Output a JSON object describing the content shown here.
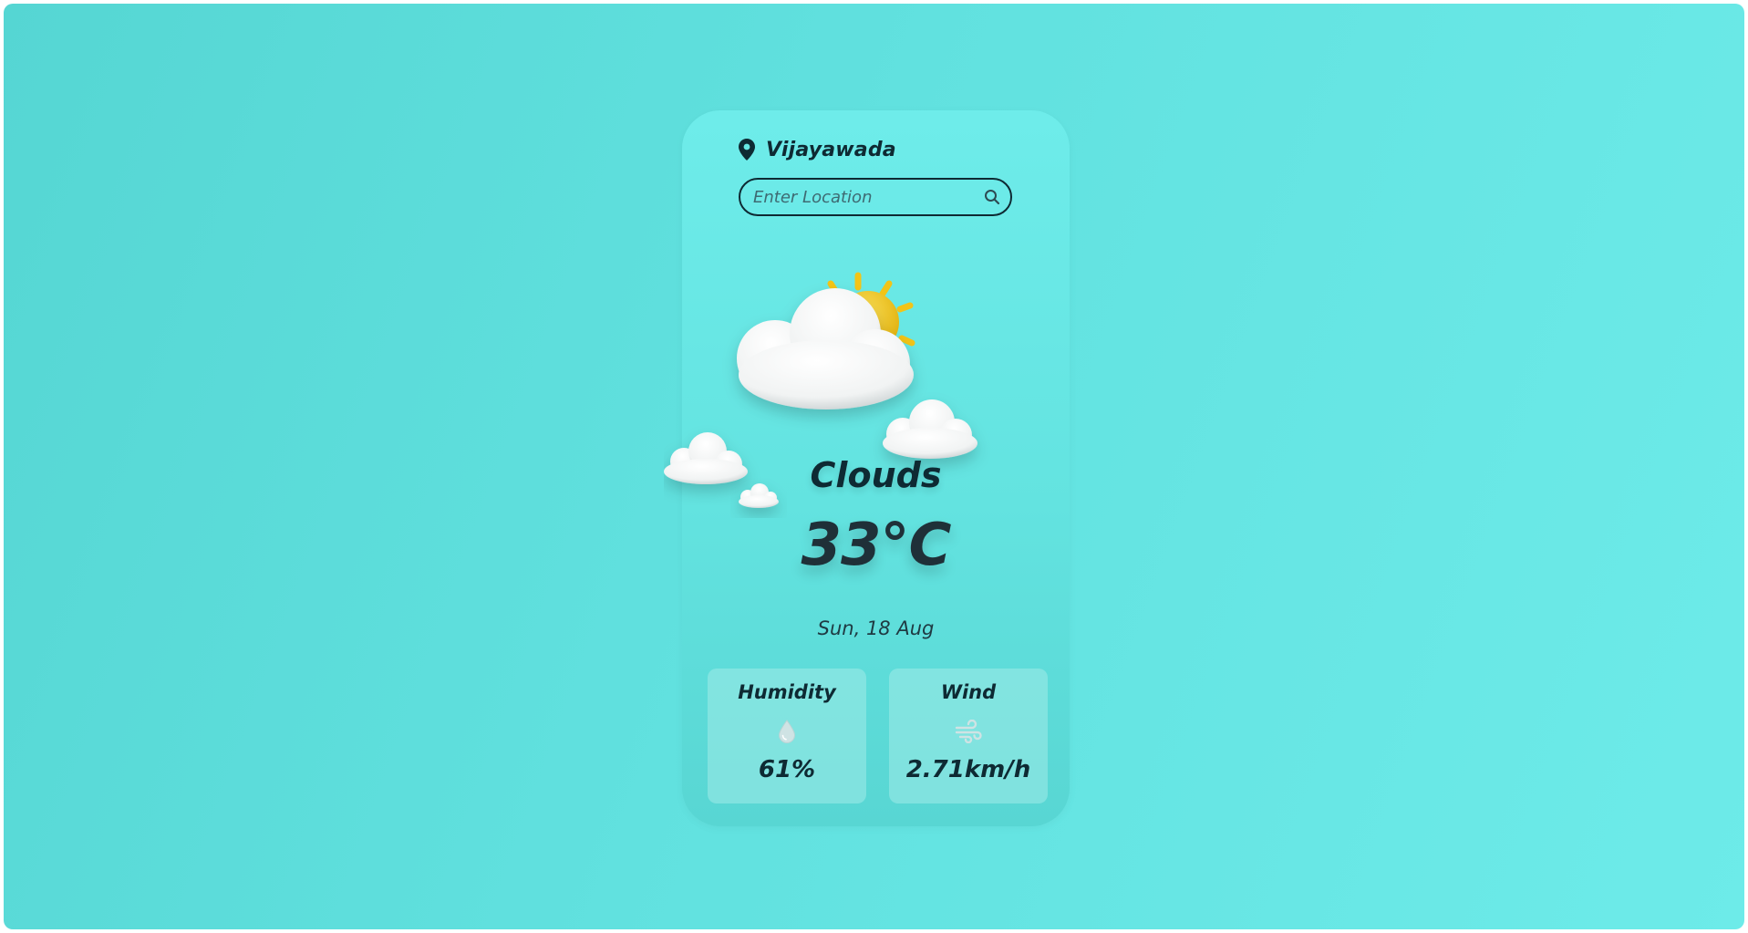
{
  "location": {
    "city": "Vijayawada",
    "icon": "map-pin-icon"
  },
  "search": {
    "placeholder": "Enter Location",
    "value": "",
    "icon": "search-icon"
  },
  "weather": {
    "condition": "Clouds",
    "temperature": "33°C",
    "date": "Sun, 18 Aug",
    "icon": "partly-cloudy-icon"
  },
  "stats": {
    "humidity": {
      "title": "Humidity",
      "value": "61%",
      "icon": "water-drop-icon"
    },
    "wind": {
      "title": "Wind",
      "value": "2.71km/h",
      "icon": "wind-icon"
    }
  },
  "colors": {
    "background": "#61e1df",
    "text": "#0e2a33",
    "sun": "#f2c417"
  }
}
